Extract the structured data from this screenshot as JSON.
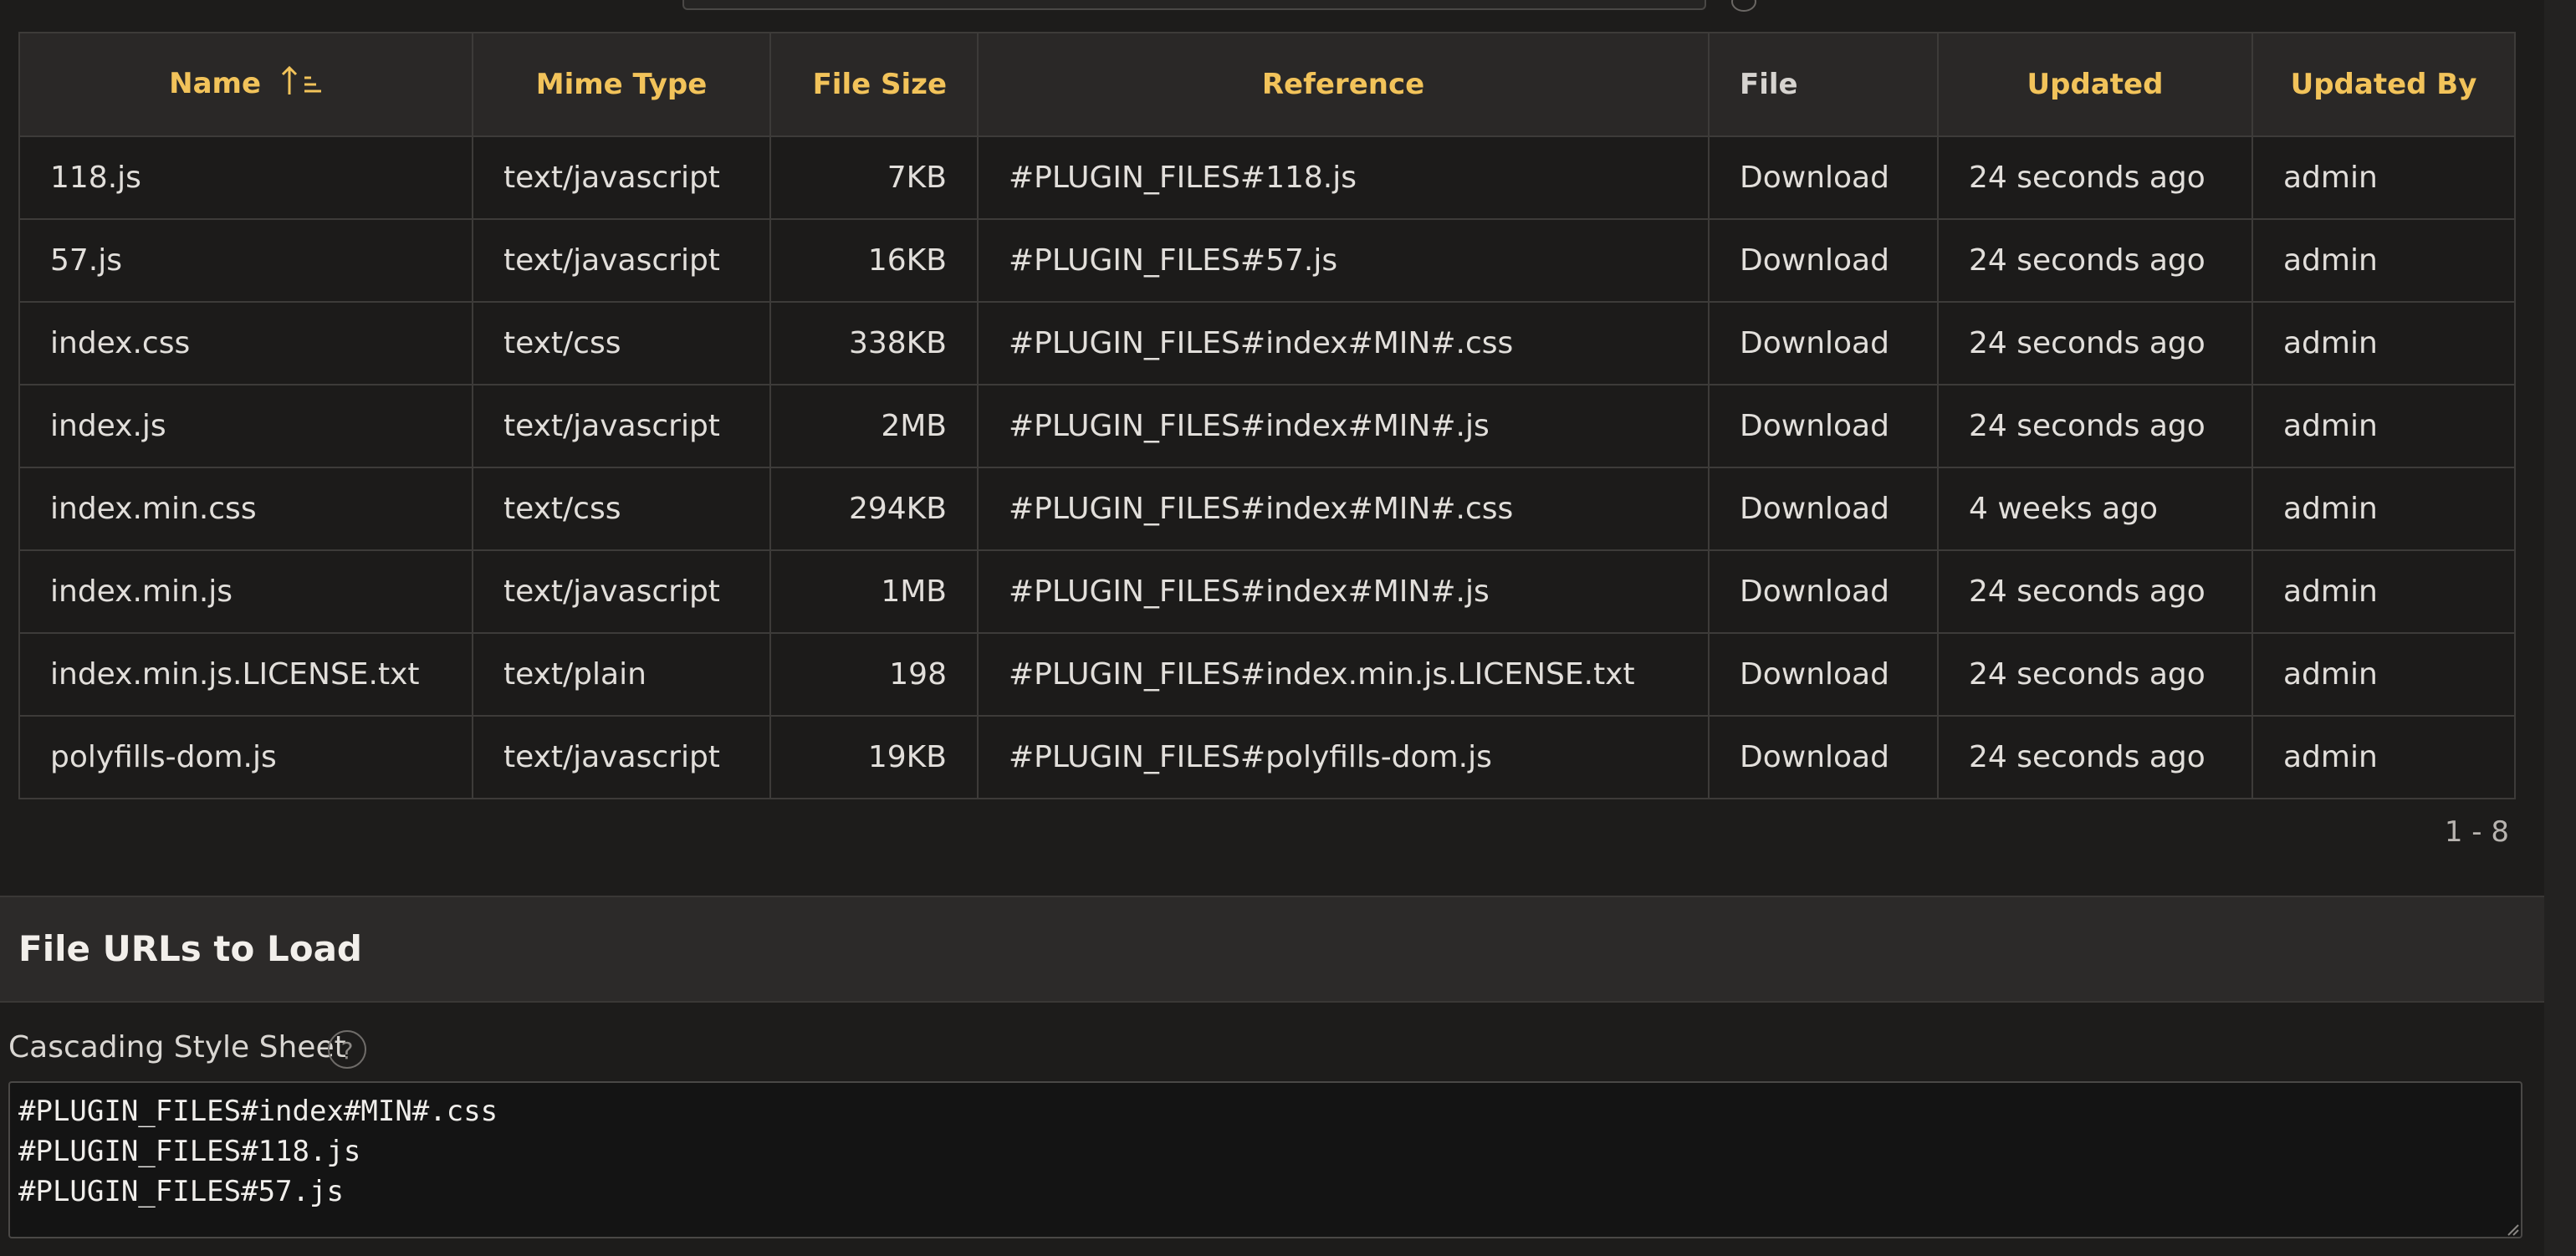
{
  "table": {
    "headers": {
      "name": "Name",
      "mime": "Mime Type",
      "size": "File Size",
      "reference": "Reference",
      "file": "File",
      "updated": "Updated",
      "updated_by": "Updated By"
    },
    "sort": {
      "column": "Name",
      "direction": "ascending"
    },
    "rows": [
      {
        "name": "118.js",
        "mime": "text/javascript",
        "size": "7KB",
        "reference": "#PLUGIN_FILES#118.js",
        "file": "Download",
        "updated": "24 seconds ago",
        "updated_by": "admin"
      },
      {
        "name": "57.js",
        "mime": "text/javascript",
        "size": "16KB",
        "reference": "#PLUGIN_FILES#57.js",
        "file": "Download",
        "updated": "24 seconds ago",
        "updated_by": "admin"
      },
      {
        "name": "index.css",
        "mime": "text/css",
        "size": "338KB",
        "reference": "#PLUGIN_FILES#index#MIN#.css",
        "file": "Download",
        "updated": "24 seconds ago",
        "updated_by": "admin"
      },
      {
        "name": "index.js",
        "mime": "text/javascript",
        "size": "2MB",
        "reference": "#PLUGIN_FILES#index#MIN#.js",
        "file": "Download",
        "updated": "24 seconds ago",
        "updated_by": "admin"
      },
      {
        "name": "index.min.css",
        "mime": "text/css",
        "size": "294KB",
        "reference": "#PLUGIN_FILES#index#MIN#.css",
        "file": "Download",
        "updated": "4 weeks ago",
        "updated_by": "admin"
      },
      {
        "name": "index.min.js",
        "mime": "text/javascript",
        "size": "1MB",
        "reference": "#PLUGIN_FILES#index#MIN#.js",
        "file": "Download",
        "updated": "24 seconds ago",
        "updated_by": "admin"
      },
      {
        "name": "index.min.js.LICENSE.txt",
        "mime": "text/plain",
        "size": "198",
        "reference": "#PLUGIN_FILES#index.min.js.LICENSE.txt",
        "file": "Download",
        "updated": "24 seconds ago",
        "updated_by": "admin"
      },
      {
        "name": "polyfills-dom.js",
        "mime": "text/javascript",
        "size": "19KB",
        "reference": "#PLUGIN_FILES#polyfills-dom.js",
        "file": "Download",
        "updated": "24 seconds ago",
        "updated_by": "admin"
      }
    ]
  },
  "pagination": {
    "range": "1 - 8"
  },
  "file_urls": {
    "title": "File URLs to Load",
    "css_label": "Cascading Style Sheet",
    "help_glyph": "?",
    "css_value": "#PLUGIN_FILES#index#MIN#.css\n#PLUGIN_FILES#118.js\n#PLUGIN_FILES#57.js"
  },
  "colors": {
    "background": "#1d1c1b",
    "header_background": "#2a2827",
    "accent": "#f4c659",
    "text": "#e2dfdb",
    "border": "#3d3b39"
  },
  "icons": {
    "sort": "sort-ascending-icon",
    "help": "help-icon",
    "resize": "resize-grip-icon"
  }
}
